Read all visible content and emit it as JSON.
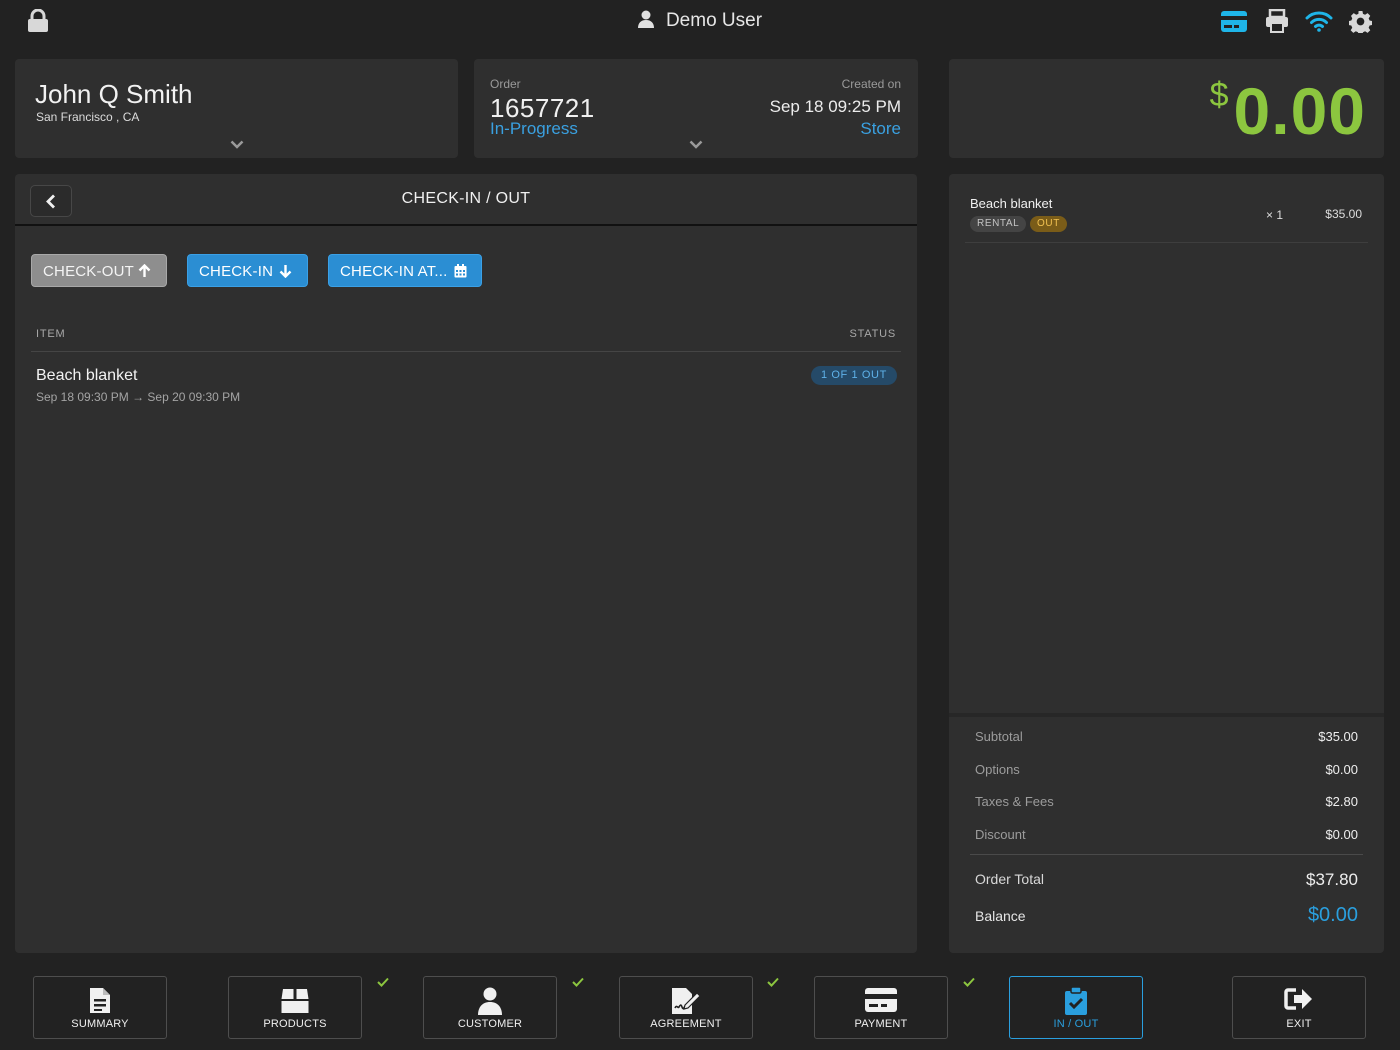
{
  "top_bar": {
    "user_name": "Demo User",
    "icons": [
      "lock-icon",
      "user-icon",
      "card-reader-icon",
      "printer-icon",
      "wifi-icon",
      "gear-icon"
    ],
    "accent_color": "#1fb5e8"
  },
  "customer": {
    "name": "John Q Smith",
    "location": "San Francisco , CA"
  },
  "order": {
    "label": "Order",
    "number": "1657721",
    "status": "In-Progress",
    "created_label": "Created on",
    "created_date": "Sep 18 09:25 PM",
    "channel": "Store"
  },
  "balance_display": {
    "currency_symbol": "$",
    "amount": "0.00",
    "color": "#8cc63f"
  },
  "checkin_panel": {
    "title": "CHECK-IN / OUT",
    "buttons": {
      "checkout": "CHECK-OUT",
      "checkin": "CHECK-IN",
      "checkin_at": "CHECK-IN AT..."
    },
    "columns": {
      "item": "ITEM",
      "status": "STATUS"
    },
    "items": [
      {
        "name": "Beach blanket",
        "dates": "Sep 18 09:30 PM → Sep 20 09:30 PM",
        "status": "1 OF 1 OUT"
      }
    ]
  },
  "cart": {
    "items": [
      {
        "name": "Beach blanket",
        "tags": [
          "RENTAL",
          "OUT"
        ],
        "qty": "× 1",
        "price": "$35.00"
      }
    ],
    "summary": {
      "subtotal_label": "Subtotal",
      "subtotal": "$35.00",
      "options_label": "Options",
      "options": "$0.00",
      "taxes_label": "Taxes & Fees",
      "taxes": "$2.80",
      "discount_label": "Discount",
      "discount": "$0.00",
      "order_total_label": "Order Total",
      "order_total": "$37.80",
      "balance_label": "Balance",
      "balance": "$0.00"
    }
  },
  "bottom_nav": {
    "summary": "SUMMARY",
    "products": "PRODUCTS",
    "customer": "CUSTOMER",
    "agreement": "AGREEMENT",
    "payment": "PAYMENT",
    "in_out": "IN / OUT",
    "exit": "EXIT",
    "active": "IN / OUT",
    "completed_color": "#8cc63f"
  }
}
